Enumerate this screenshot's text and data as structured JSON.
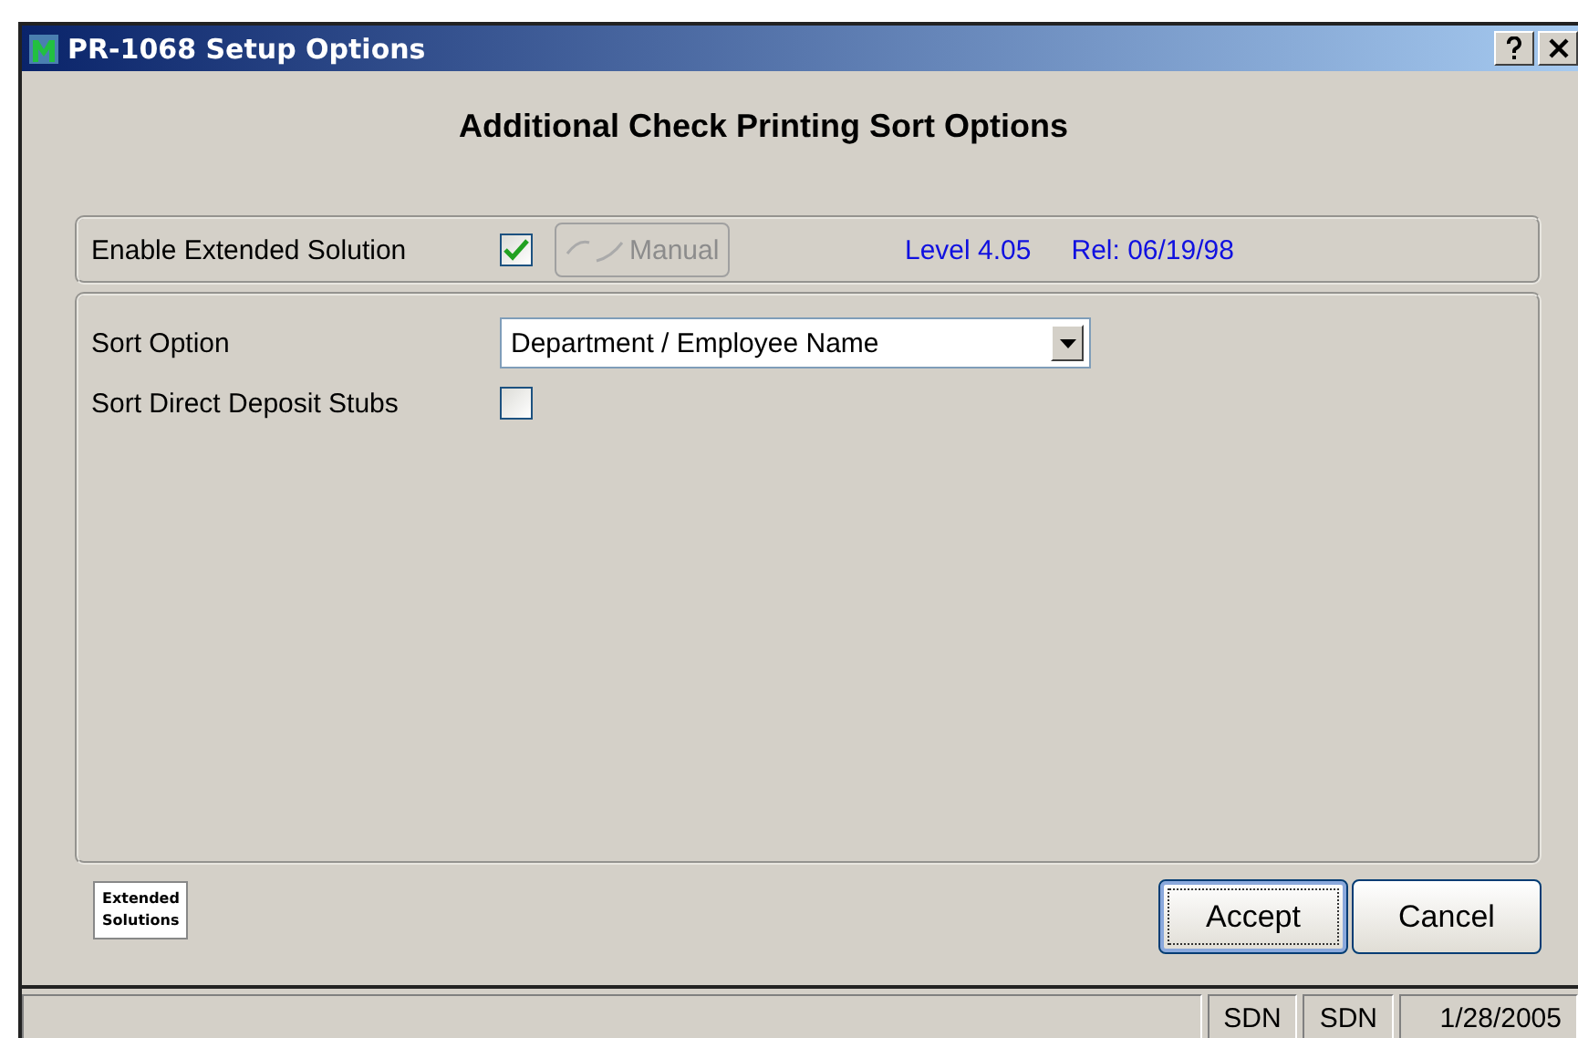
{
  "window": {
    "title": "PR-1068 Setup Options"
  },
  "heading": "Additional Check Printing Sort Options",
  "enable": {
    "label": "Enable Extended Solution",
    "checked": true,
    "manual_button": {
      "label": "Manual",
      "disabled": true
    },
    "level": "Level 4.05",
    "release": "Rel: 06/19/98"
  },
  "sort_option": {
    "label": "Sort Option",
    "value": "Department / Employee Name"
  },
  "sort_direct_deposit": {
    "label": "Sort Direct Deposit Stubs",
    "checked": false
  },
  "logo": [
    "Extended",
    "Solutions"
  ],
  "buttons": [
    {
      "label": "Accept",
      "default": true
    },
    {
      "label": "Cancel",
      "default": false
    }
  ],
  "status_bar": [
    "SDN",
    "SDN",
    "1/28/2005"
  ]
}
